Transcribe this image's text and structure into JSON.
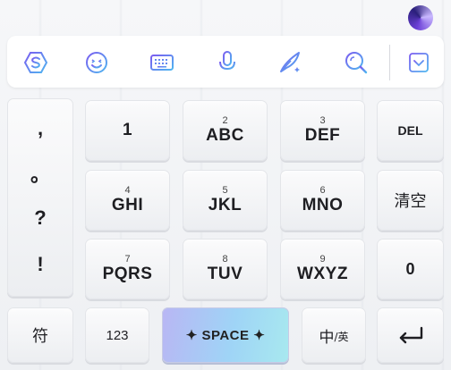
{
  "toolbar": {
    "icons": [
      {
        "name": "logo-icon"
      },
      {
        "name": "emoji-icon"
      },
      {
        "name": "keyboard-icon"
      },
      {
        "name": "microphone-icon"
      },
      {
        "name": "handwriting-icon"
      },
      {
        "name": "search-icon"
      },
      {
        "name": "collapse-icon"
      }
    ]
  },
  "punctuation": [
    ",",
    "。",
    "?",
    "!"
  ],
  "keys": {
    "k1": {
      "letters": "1"
    },
    "k2": {
      "num": "2",
      "letters": "ABC"
    },
    "k3": {
      "num": "3",
      "letters": "DEF"
    },
    "del": {
      "label": "DEL"
    },
    "k4": {
      "num": "4",
      "letters": "GHI"
    },
    "k5": {
      "num": "5",
      "letters": "JKL"
    },
    "k6": {
      "num": "6",
      "letters": "MNO"
    },
    "clear": {
      "label": "清空"
    },
    "k7": {
      "num": "7",
      "letters": "PQRS"
    },
    "k8": {
      "num": "8",
      "letters": "TUV"
    },
    "k9": {
      "num": "9",
      "letters": "WXYZ"
    },
    "k0": {
      "label": "0"
    }
  },
  "bottom": {
    "symbol": "符",
    "numeric": "123",
    "space": "✦ SPACE ✦",
    "lang_main": "中",
    "lang_sub": "/英"
  },
  "colors": {
    "accent_from": "#7a5cf0",
    "accent_to": "#4fb6f0"
  }
}
